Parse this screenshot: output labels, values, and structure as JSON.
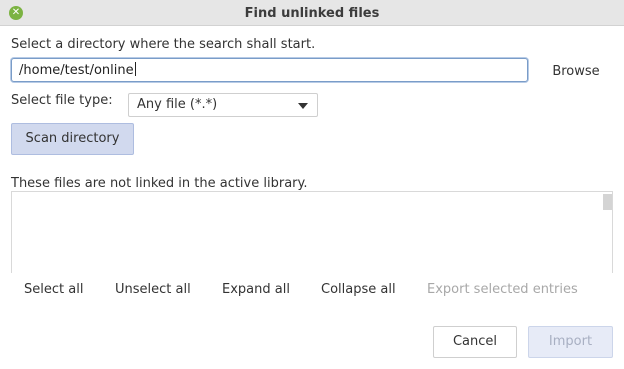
{
  "window": {
    "title": "Find unlinked files",
    "close_icon": "close-icon"
  },
  "directory": {
    "prompt": "Select a directory where the search shall start.",
    "path_value": "/home/test/online",
    "browse_label": "Browse"
  },
  "file_type": {
    "label": "Select file type:",
    "selected": "Any file (*.*)"
  },
  "scan_label": "Scan directory",
  "results": {
    "caption": "These files are not linked in the active library."
  },
  "actions": {
    "select_all": "Select all",
    "unselect_all": "Unselect all",
    "expand_all": "Expand all",
    "collapse_all": "Collapse all",
    "export_selected": "Export selected entries"
  },
  "footer": {
    "cancel": "Cancel",
    "import": "Import"
  },
  "colors": {
    "accent": "#d1d9ee",
    "close_button": "#7cb342",
    "disabled_text": "#a8a8a8"
  }
}
